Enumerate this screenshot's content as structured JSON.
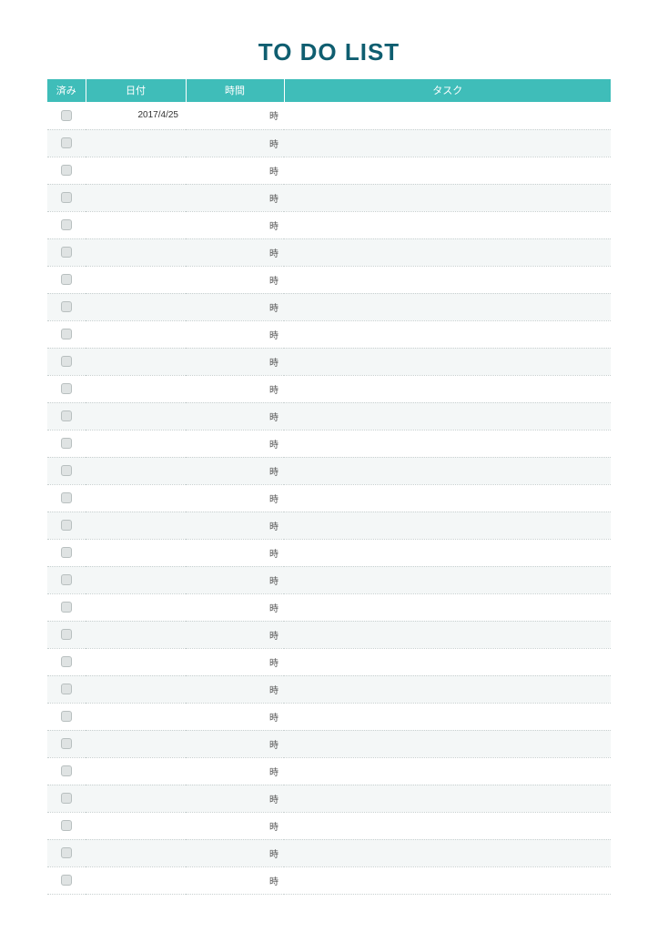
{
  "title": "TO DO LIST",
  "columns": {
    "done": "済み",
    "date": "日付",
    "time": "時間",
    "task": "タスク"
  },
  "time_suffix": "時",
  "rows": [
    {
      "done": false,
      "date": "2017/4/25",
      "time": "時",
      "task": ""
    },
    {
      "done": false,
      "date": "",
      "time": "時",
      "task": ""
    },
    {
      "done": false,
      "date": "",
      "time": "時",
      "task": ""
    },
    {
      "done": false,
      "date": "",
      "time": "時",
      "task": ""
    },
    {
      "done": false,
      "date": "",
      "time": "時",
      "task": ""
    },
    {
      "done": false,
      "date": "",
      "time": "時",
      "task": ""
    },
    {
      "done": false,
      "date": "",
      "time": "時",
      "task": ""
    },
    {
      "done": false,
      "date": "",
      "time": "時",
      "task": ""
    },
    {
      "done": false,
      "date": "",
      "time": "時",
      "task": ""
    },
    {
      "done": false,
      "date": "",
      "time": "時",
      "task": ""
    },
    {
      "done": false,
      "date": "",
      "time": "時",
      "task": ""
    },
    {
      "done": false,
      "date": "",
      "time": "時",
      "task": ""
    },
    {
      "done": false,
      "date": "",
      "time": "時",
      "task": ""
    },
    {
      "done": false,
      "date": "",
      "time": "時",
      "task": ""
    },
    {
      "done": false,
      "date": "",
      "time": "時",
      "task": ""
    },
    {
      "done": false,
      "date": "",
      "time": "時",
      "task": ""
    },
    {
      "done": false,
      "date": "",
      "time": "時",
      "task": ""
    },
    {
      "done": false,
      "date": "",
      "time": "時",
      "task": ""
    },
    {
      "done": false,
      "date": "",
      "time": "時",
      "task": ""
    },
    {
      "done": false,
      "date": "",
      "time": "時",
      "task": ""
    },
    {
      "done": false,
      "date": "",
      "time": "時",
      "task": ""
    },
    {
      "done": false,
      "date": "",
      "time": "時",
      "task": ""
    },
    {
      "done": false,
      "date": "",
      "time": "時",
      "task": ""
    },
    {
      "done": false,
      "date": "",
      "time": "時",
      "task": ""
    },
    {
      "done": false,
      "date": "",
      "time": "時",
      "task": ""
    },
    {
      "done": false,
      "date": "",
      "time": "時",
      "task": ""
    },
    {
      "done": false,
      "date": "",
      "time": "時",
      "task": ""
    },
    {
      "done": false,
      "date": "",
      "time": "時",
      "task": ""
    },
    {
      "done": false,
      "date": "",
      "time": "時",
      "task": ""
    }
  ],
  "colors": {
    "header_bg": "#3fbdb9",
    "title": "#0f5e70",
    "alt_row": "#f4f7f7"
  }
}
